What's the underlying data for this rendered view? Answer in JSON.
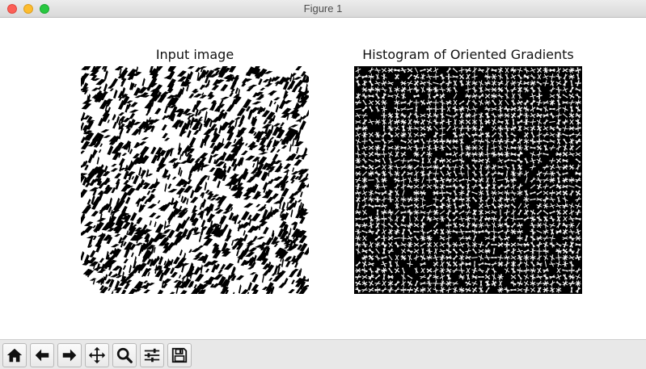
{
  "window": {
    "title": "Figure 1"
  },
  "figure": {
    "left_axes": {
      "title": "Input image"
    },
    "right_axes": {
      "title": "Histogram of Oriented Gradients"
    }
  },
  "toolbar": {
    "buttons": [
      {
        "name": "home-button",
        "icon": "home-icon"
      },
      {
        "name": "back-button",
        "icon": "arrow-left-icon"
      },
      {
        "name": "forward-button",
        "icon": "arrow-right-icon"
      },
      {
        "name": "pan-button",
        "icon": "move-icon"
      },
      {
        "name": "zoom-button",
        "icon": "magnifier-icon"
      },
      {
        "name": "configure-subplots-button",
        "icon": "sliders-icon"
      },
      {
        "name": "save-button",
        "icon": "floppy-disk-icon"
      }
    ]
  },
  "colors": {
    "traffic_close": "#fc5f57",
    "traffic_minimize": "#fdbc2e",
    "traffic_zoom": "#28c840",
    "image_fg": "#000000",
    "image_bg": "#ffffff"
  }
}
